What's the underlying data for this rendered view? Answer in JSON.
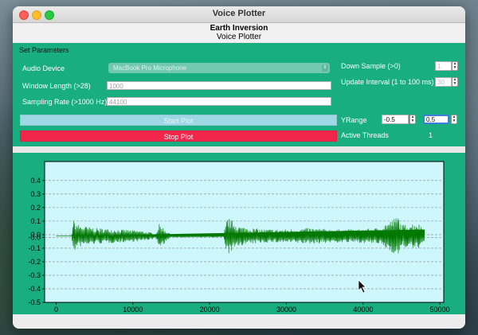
{
  "window": {
    "title": "Voice Plotter"
  },
  "header": {
    "title": "Earth Inversion",
    "subtitle": "Voice Plotter"
  },
  "params": {
    "section_title": "Set Parameters",
    "audio_device_label": "Audio Device",
    "audio_device_value": "MacBook Pro Microphone",
    "window_length_label": "Window Length (>28)",
    "window_length_placeholder": "1000",
    "sampling_rate_label": "Sampling Rate (>1000 Hz)",
    "sampling_rate_placeholder": "44100",
    "down_sample_label": "Down Sample (>0)",
    "down_sample_value": "1",
    "update_interval_label": "Update Interval (1 to 100 ms)",
    "update_interval_value": "30",
    "start_plot_label": "Start Plot",
    "stop_plot_label": "Stop Plot",
    "yrange_label": "YRange",
    "yrange_min": "-0.5",
    "yrange_max": "0.5",
    "active_threads_label": "Active Threads",
    "active_threads_value": "1"
  },
  "colors": {
    "panel_bg": "#18ae7f",
    "plot_bg": "#cdf7fa",
    "waveform": "#007800",
    "stop_button": "#f2264b",
    "start_button": "#9ed8e5"
  },
  "chart_data": {
    "type": "line",
    "title": "",
    "xlabel": "",
    "ylabel": "",
    "xlim": [
      -1500,
      50500
    ],
    "ylim": [
      -0.5,
      0.5
    ],
    "xticks": [
      0,
      10000,
      20000,
      30000,
      40000,
      50000
    ],
    "xtick_labels": [
      "0",
      "10000",
      "20000",
      "30000",
      "40000",
      "50000"
    ],
    "yticks": [
      0.4,
      0.3,
      0.2,
      0.1,
      0.0,
      -0.1,
      -0.2,
      -0.3,
      -0.4,
      -0.5
    ],
    "ytick_labels": [
      "0.4",
      "0.3",
      "0.2",
      "0.1",
      "0.0",
      "-0.0",
      "-0.1",
      "-0.2",
      "-0.3",
      "-0.4",
      "-0.5"
    ],
    "grid": "horizontal dashed",
    "series": [
      {
        "x": [
          0,
          2000,
          2200,
          3000,
          5000,
          8000,
          11000,
          13000,
          13400,
          15000,
          20000,
          21800,
          22300,
          24000,
          27000,
          30000,
          33000,
          36000,
          39000,
          42000,
          44600,
          45000,
          47000,
          48000
        ],
        "amplitude": [
          0.0,
          0.0,
          0.12,
          0.08,
          0.06,
          0.05,
          0.04,
          0.02,
          0.09,
          0.01,
          0.01,
          0.01,
          0.14,
          0.07,
          0.05,
          0.05,
          0.06,
          0.05,
          0.05,
          0.06,
          0.15,
          0.08,
          0.1,
          0.06
        ]
      }
    ]
  }
}
